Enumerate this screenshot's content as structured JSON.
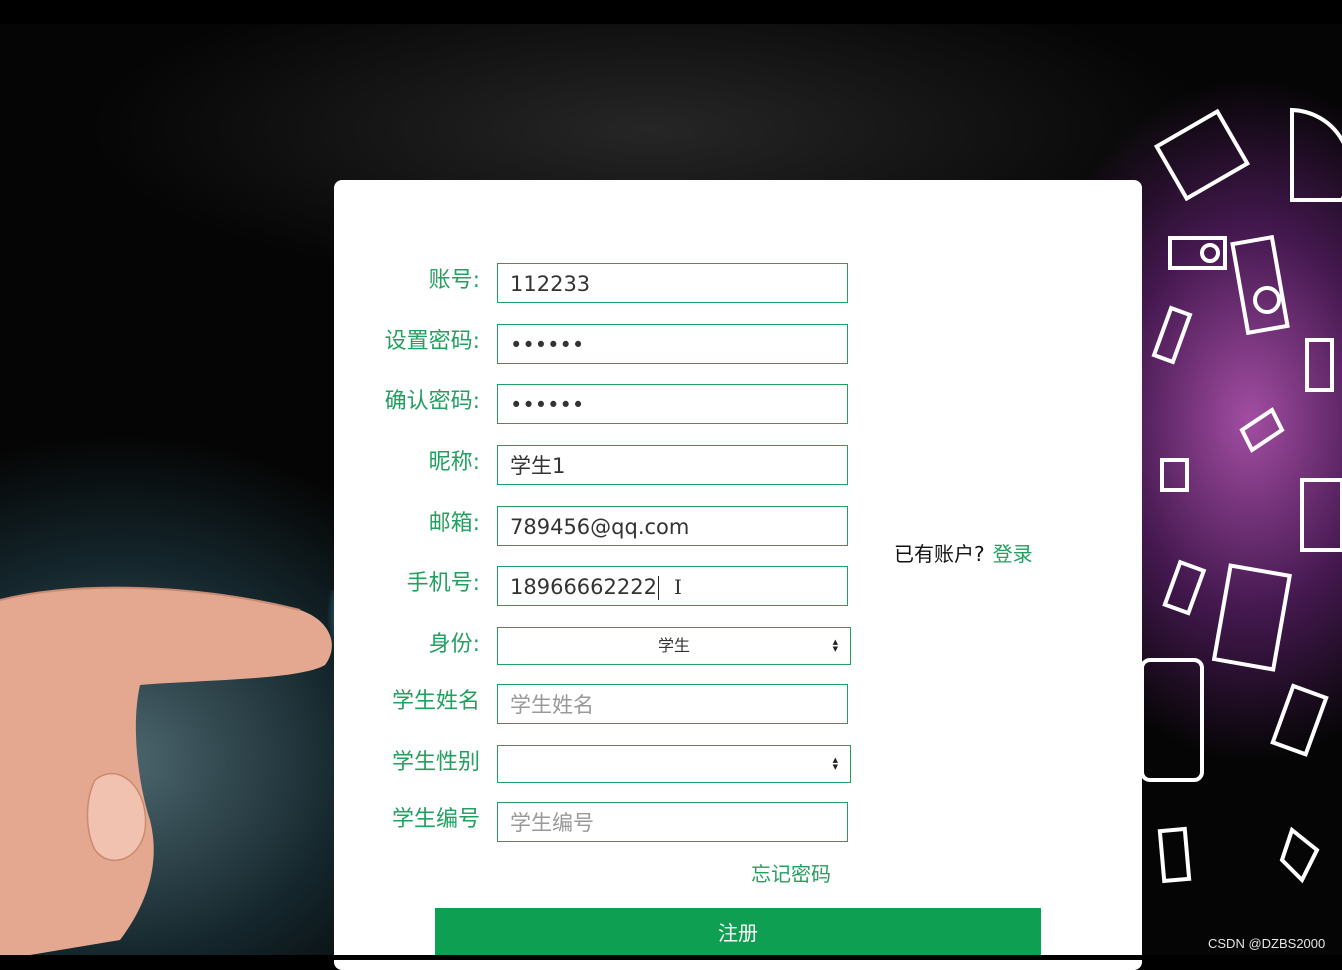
{
  "form": {
    "account": {
      "label": "账号:",
      "value": "112233"
    },
    "password": {
      "label": "设置密码:",
      "value": "••••••"
    },
    "confirm_password": {
      "label": "确认密码:",
      "value": "••••••"
    },
    "nickname": {
      "label": "昵称:",
      "value": "学生1"
    },
    "email": {
      "label": "邮箱:",
      "value": "789456@qq.com"
    },
    "phone": {
      "label": "手机号:",
      "value": "18966662222"
    },
    "role": {
      "label": "身份:",
      "selected": "学生"
    },
    "student_name": {
      "label": "学生姓名",
      "placeholder": "学生姓名"
    },
    "student_gender": {
      "label": "学生性别",
      "selected": ""
    },
    "student_number": {
      "label": "学生编号",
      "placeholder": "学生编号"
    },
    "forgot_password": "忘记密码",
    "submit_label": "注册"
  },
  "side": {
    "have_account_text": "已有账户?",
    "login_link": "登录"
  },
  "watermark": "CSDN @DZBS2000",
  "colors": {
    "accent": "#22a060",
    "button": "#0e9f52"
  }
}
